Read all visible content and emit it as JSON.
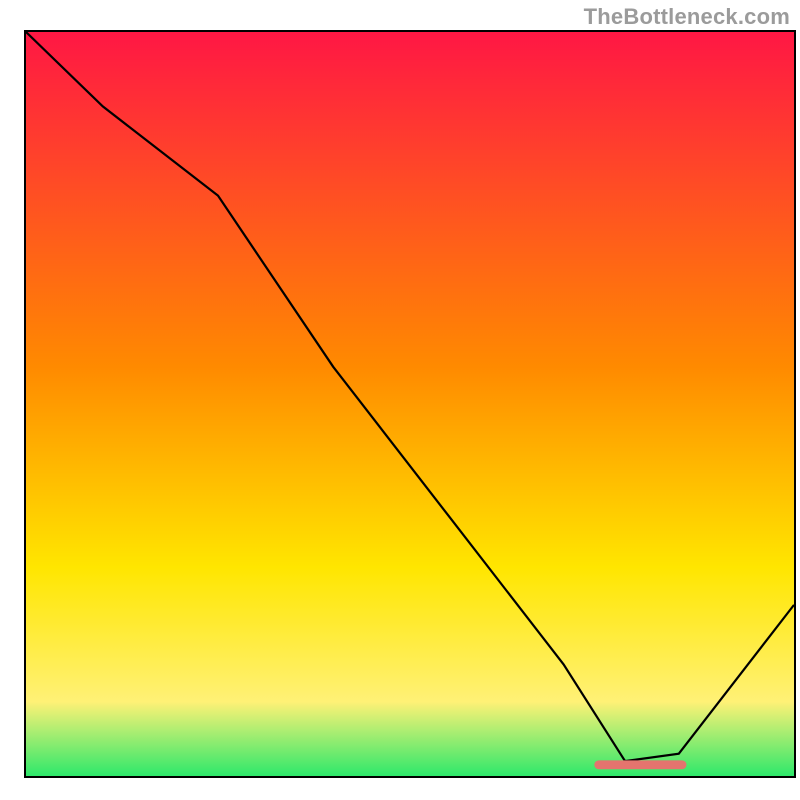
{
  "watermark": "TheBottleneck.com",
  "gradient": {
    "top": "#ff1744",
    "mid1": "#ff8a00",
    "mid2": "#ffe600",
    "mid3": "#fff176",
    "bottom": "#2ee86b"
  },
  "chart_data": {
    "type": "line",
    "title": "",
    "xlabel": "",
    "ylabel": "",
    "xlim": [
      0,
      100
    ],
    "ylim": [
      0,
      100
    ],
    "x": [
      0,
      10,
      25,
      40,
      55,
      70,
      78,
      85,
      100
    ],
    "bottleneck": [
      100,
      90,
      78,
      55,
      35,
      15,
      2,
      3,
      23
    ],
    "marker": {
      "x_start": 74,
      "x_end": 86,
      "y": 1.5,
      "color": "#e5746e"
    }
  }
}
